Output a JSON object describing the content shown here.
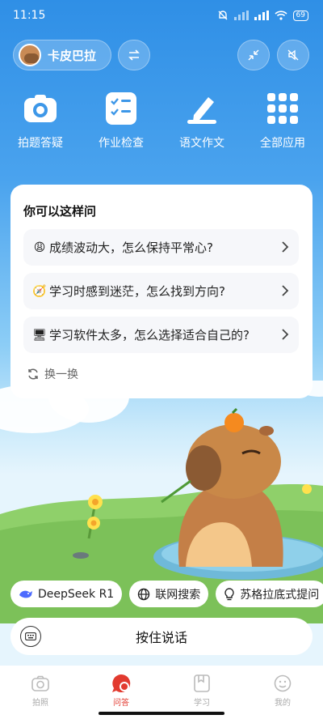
{
  "status_bar": {
    "time": "11:15",
    "battery": "69"
  },
  "header": {
    "username": "卡皮巴拉"
  },
  "apps": [
    {
      "label": "拍题答疑",
      "icon": "camera-icon"
    },
    {
      "label": "作业检查",
      "icon": "checklist-icon"
    },
    {
      "label": "语文作文",
      "icon": "pen-icon"
    },
    {
      "label": "全部应用",
      "icon": "grid-icon"
    }
  ],
  "suggestions": {
    "title": "你可以这样问",
    "items": [
      {
        "emoji": "😩",
        "text": "成绩波动大，怎么保持平常心?"
      },
      {
        "emoji": "🧭",
        "text": "学习时感到迷茫，怎么找到方向?"
      },
      {
        "emoji": "🖥",
        "text": "学习软件太多，怎么选择适合自己的?"
      }
    ],
    "refresh_label": "换一换"
  },
  "chips": [
    {
      "label": "DeepSeek R1",
      "icon": "whale-icon"
    },
    {
      "label": "联网搜索",
      "icon": "globe-icon"
    },
    {
      "label": "苏格拉底式提问",
      "icon": "bulb-icon"
    }
  ],
  "voice": {
    "label": "按住说话"
  },
  "tabs": [
    {
      "label": "拍照",
      "icon": "camera-icon",
      "active": false
    },
    {
      "label": "问答",
      "icon": "chat-icon",
      "active": true
    },
    {
      "label": "学习",
      "icon": "book-icon",
      "active": false
    },
    {
      "label": "我的",
      "icon": "face-icon",
      "active": false
    }
  ],
  "colors": {
    "accent": "#e23a2f",
    "sky_top": "#2f8fe6",
    "grass": "#8fd06a"
  }
}
